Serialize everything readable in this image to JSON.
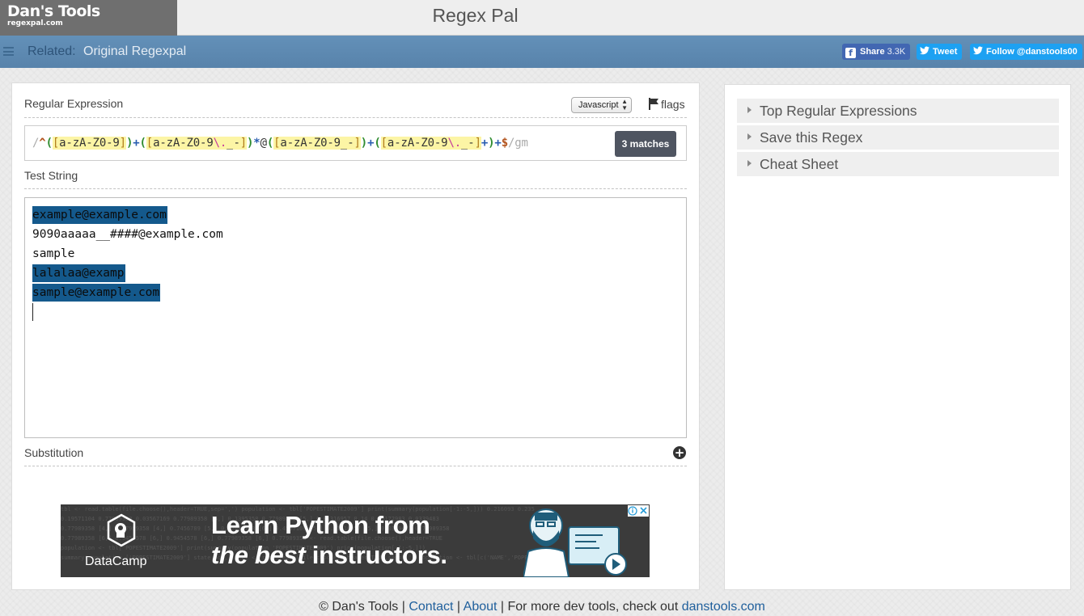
{
  "header": {
    "logo_title": "Dan's Tools",
    "logo_subtitle": "regexpal.com",
    "app_title": "Regex Pal"
  },
  "navbar": {
    "related_label": "Related:",
    "related_link": "Original Regexpal",
    "social": {
      "share_label": "Share",
      "share_count": "3.3K",
      "tweet_label": "Tweet",
      "follow_label": "Follow @danstools00"
    }
  },
  "editor": {
    "regex_label": "Regular Expression",
    "flavor": "Javascript",
    "flags_label": "flags",
    "regex": {
      "open_delim": "/",
      "pattern": "^([a-zA-Z0-9])+([a-zA-Z0-9\\._-])*@([a-zA-Z0-9_-])+([a-zA-Z0-9\\._-]+)+$",
      "close_delim": "/",
      "flags": "gm"
    },
    "match_count": "3 matches",
    "test_label": "Test String",
    "test_lines": [
      {
        "text": "example@example.com",
        "matched": true
      },
      {
        "text": "9090aaaaa__####@example.com",
        "matched": false
      },
      {
        "text": "sample",
        "matched": false
      },
      {
        "text": "lalalaa@examp",
        "matched": true
      },
      {
        "text": "sample@example.com",
        "matched": true
      }
    ],
    "substitution_label": "Substitution"
  },
  "ad": {
    "brand": "DataCamp",
    "headline_line1": "Learn Python from",
    "headline_line2_italic": "the best",
    "headline_line2_rest": " instructors.",
    "code_lines": [
      "tbl <- read.table(file.choose(),header=TRUE,sep=',') population <- tbl['POPESTIMATE2009'] print(summary(population[-1:-5,])) 0.216093 0.235",
      "0.19571104 0.77989358 0.03567169 0.77989358 [5,] 0.1395358 0.77989358 [5,] 0.01316957 0.14 0.46172983 0.0339483",
      "0.77989358 [4,] 0.77989358 [4,] 0.7456789 [5,] 0.77989358 [6,] 0.4567169 [5,] 0.01316957 [5,] 0.0339483 0.77989358",
      "0.77989358 [6,] 0.9454578 [6,] 0.9454578 [6,] 0.77989358 [6,] 0.77989358 <- read.table(file.choose(),header=TRUE",
      "population <- tbl['POPESTIMATE2009'] print(summary(population 'POPESTIMATE2009') print(population[-1:-5,]))",
      "summary(population ['POPESTIMATE2009'] state.pop,]) tbl <- read.table(file.choose(),header=TRUE,sep=',') population <- tbl[c('NAME','POPESTIMATE2009"
    ]
  },
  "sidebar": {
    "items": [
      {
        "label": "Top Regular Expressions"
      },
      {
        "label": "Save this Regex"
      },
      {
        "label": "Cheat Sheet"
      }
    ]
  },
  "footer": {
    "copyright": "© Dan's Tools",
    "sep1": " | ",
    "contact": "Contact",
    "sep2": " | ",
    "about": "About",
    "text": " | For more dev tools, check out ",
    "site_link": "danstools.com"
  },
  "colors": {
    "nav_bg": "#5c89b2",
    "match_highlight": "#14598c",
    "badge_bg": "#4f5561",
    "link": "#1f5f9c",
    "twitter": "#1da1f2",
    "facebook": "#4267b2"
  }
}
